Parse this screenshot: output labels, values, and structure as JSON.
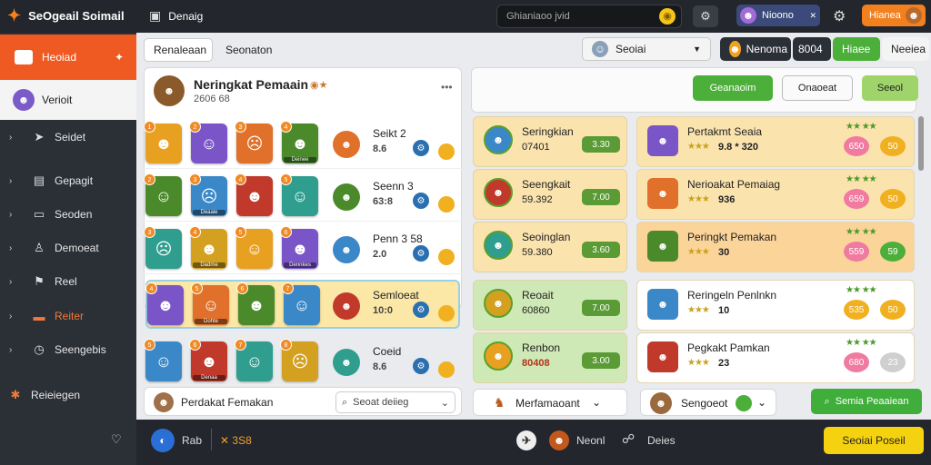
{
  "topbar": {
    "app_title": "SeOgeail Soimail",
    "nav_label": "Denaig",
    "search_placeholder": "Ghianiaoo jvid",
    "user_name": "Nioono",
    "orange_label": "Hianea"
  },
  "sidebar": {
    "items": [
      {
        "label": "Heoiad",
        "icon": "home-icon"
      },
      {
        "label": "Verioit",
        "icon": "avatar-icon"
      },
      {
        "label": "Seidet",
        "icon": "arrow-icon"
      },
      {
        "label": "Gepagit",
        "icon": "book-icon"
      },
      {
        "label": "Seoden",
        "icon": "box-icon"
      },
      {
        "label": "Demoeat",
        "icon": "person-icon"
      },
      {
        "label": "Reel",
        "icon": "flag-icon"
      },
      {
        "label": "Reiter",
        "icon": "doc-icon"
      },
      {
        "label": "Seengebis",
        "icon": "clock-icon"
      },
      {
        "label": "Reieiegen",
        "icon": "gear-icon"
      }
    ]
  },
  "tabs": {
    "tab1": "Renaleaan",
    "tab2": "Seonaton",
    "select_label": "Seoiai",
    "user_chip": "Nenoma",
    "num": "8004",
    "green_tab": "Hiaee",
    "grey_tab": "Neeiea"
  },
  "left_panel": {
    "title": "Neringkat Pemaain",
    "subtitle": "2606 68",
    "rows": [
      {
        "name": "Seikt 2",
        "score": "8.6"
      },
      {
        "name": "Seenn 3",
        "score": "63:8"
      },
      {
        "name": "Penn 3 58",
        "score": "2.0"
      },
      {
        "name": "Semloeat",
        "score": "10:0"
      },
      {
        "name": "Coeid",
        "score": "8.6"
      }
    ],
    "hero_tags": [
      "Deinee",
      "Deaaie",
      "Dadme",
      "Dennkes",
      "Dohte",
      "Denaa"
    ],
    "footer_label": "Perdakat Femakan",
    "footer_search": "Seoat deiieg"
  },
  "mid_panel": {
    "rows": [
      {
        "name": "Seringkian",
        "score": "07401",
        "pill": "3.30"
      },
      {
        "name": "Seengkait",
        "score": "59.392",
        "pill": "7.00"
      },
      {
        "name": "Seoinglan",
        "score": "59.380",
        "pill": "3.60"
      },
      {
        "name": "Reoait",
        "score": "60860",
        "pill": "7.00"
      },
      {
        "name": "Renbon",
        "score": "80408",
        "pill": "3.00"
      }
    ],
    "footer_label": "Merfamaoant"
  },
  "right_panel": {
    "btn_green": "Geanaoim",
    "btn_white": "Onaoeat",
    "btn_light_green": "Seeol",
    "rows": [
      {
        "name": "Pertakmt Seaia",
        "score": "9.8 * 320",
        "b1": "650",
        "b2": "50"
      },
      {
        "name": "Nerioakat Pemaiag",
        "score": "936",
        "b1": "659",
        "b2": "50"
      },
      {
        "name": "Peringkt Pemakan",
        "score": "30",
        "b1": "559",
        "b2": "59"
      },
      {
        "name": "Reringeln Penlnkn",
        "score": "10",
        "b1": "535",
        "b2": "50"
      },
      {
        "name": "Pegkakt Pamkan",
        "score": "23",
        "b1": "680",
        "b2": "23"
      }
    ],
    "footer_label": "Sengoeot",
    "footer_green": "Semia Peaaiean"
  },
  "bottombar": {
    "left_label": "Rab",
    "left_num": "3S8",
    "mid_label": "Neonl",
    "mid_label2": "Deies",
    "yellow_btn": "Seoiai Poseil"
  },
  "colors": {
    "accent": "#ef5a22",
    "green": "#4caf3a",
    "yellow": "#f5d20f"
  }
}
